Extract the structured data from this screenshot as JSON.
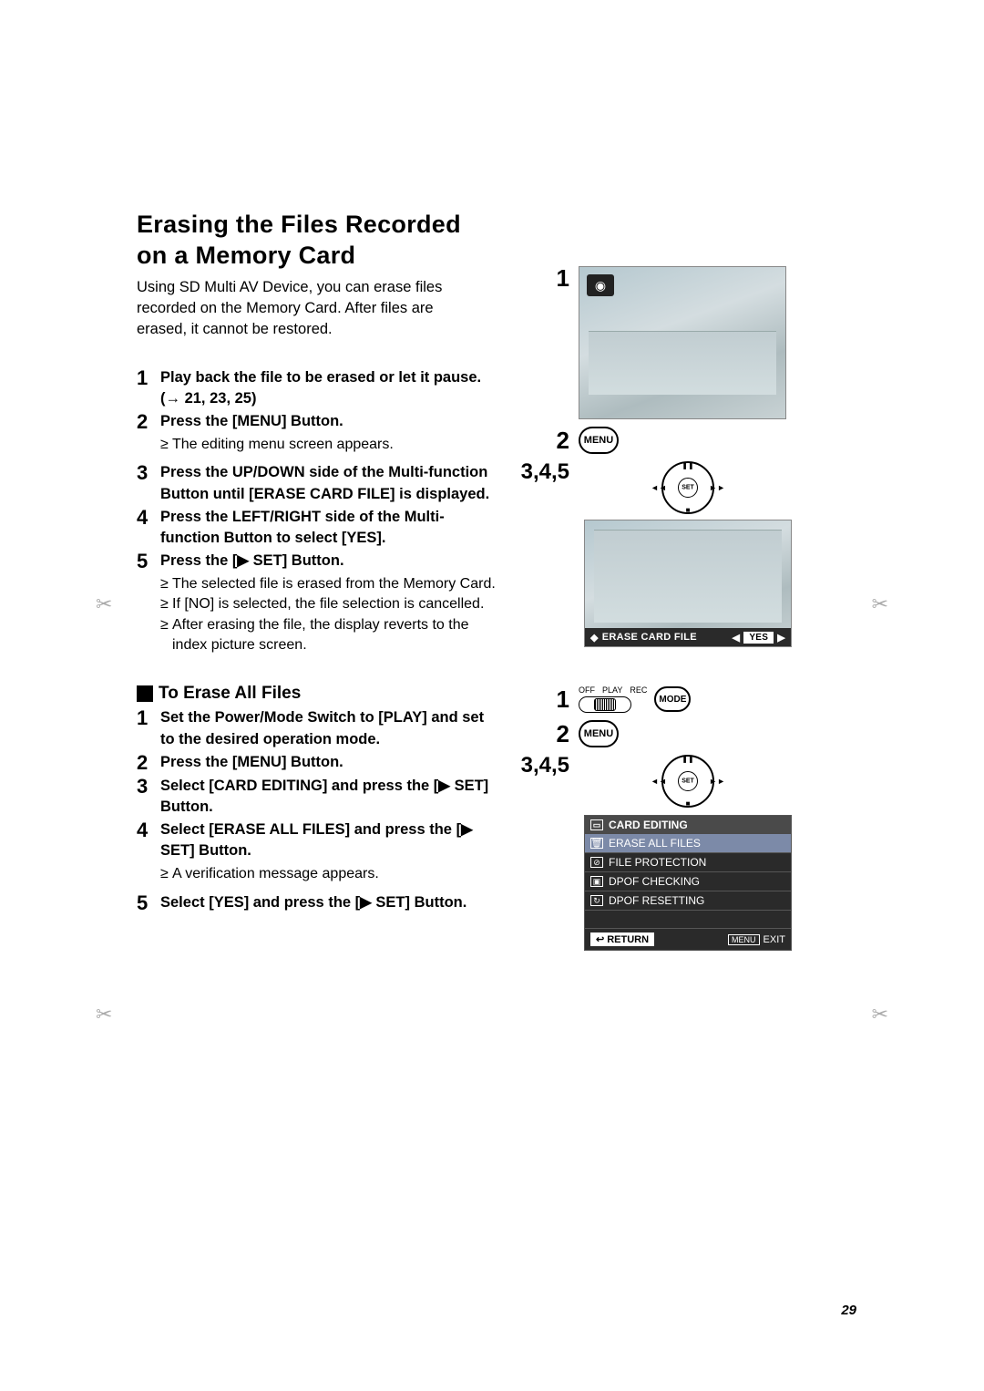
{
  "page": {
    "title": "Erasing the Files Recorded on a Memory Card",
    "intro": "Using SD Multi AV Device, you can erase files recorded on the Memory Card. After files are erased, it cannot be restored.",
    "page_number": "29"
  },
  "stepsA": [
    {
      "n": "1",
      "main": "Play back the file to be erased or let it pause. (→ 21, 23, 25)",
      "bullets": []
    },
    {
      "n": "2",
      "main": "Press the [MENU] Button.",
      "bullets": [
        "The editing menu screen appears."
      ]
    },
    {
      "n": "3",
      "main": "Press the UP/DOWN side of the Multi-function Button until [ERASE CARD FILE] is displayed.",
      "bullets": []
    },
    {
      "n": "4",
      "main": "Press the LEFT/RIGHT side of the Multi-function Button to select [YES].",
      "bullets": []
    },
    {
      "n": "5",
      "main": "Press the [▶ SET] Button.",
      "bullets": [
        "The selected file is erased from the Memory Card.",
        "If [NO] is selected, the file selection is cancelled.",
        "After erasing the file, the display reverts to the index picture screen."
      ]
    }
  ],
  "subheading": "To Erase All Files",
  "stepsB": [
    {
      "n": "1",
      "main": "Set the Power/Mode Switch to [PLAY] and set to the desired operation mode.",
      "bullets": []
    },
    {
      "n": "2",
      "main": "Press the [MENU] Button.",
      "bullets": []
    },
    {
      "n": "3",
      "main": "Select [CARD EDITING] and press the [▶ SET] Button.",
      "bullets": []
    },
    {
      "n": "4",
      "main": "Select [ERASE ALL FILES] and press the [▶ SET] Button.",
      "bullets": [
        "A verification message appears."
      ]
    },
    {
      "n": "5",
      "main": "Select [YES] and press the [▶ SET] Button.",
      "bullets": []
    }
  ],
  "figsA": {
    "step1": "1",
    "step2": "2",
    "step345": "3,4,5",
    "menu_label": "MENU",
    "barlabel": "ERASE CARD FILE",
    "yes": "YES",
    "joy_set": "SET"
  },
  "figsB": {
    "step1": "1",
    "step2": "2",
    "step345": "3,4,5",
    "mode_off": "OFF",
    "mode_play": "PLAY",
    "mode_rec": "REC",
    "mode_btn": "MODE",
    "menu_label": "MENU"
  },
  "menu_panel": {
    "title": "CARD EDITING",
    "rows": [
      "ERASE ALL FILES",
      "FILE PROTECTION",
      "DPOF CHECKING",
      "DPOF RESETTING"
    ],
    "return": "RETURN",
    "footer_menu": "MENU",
    "footer_exit": "EXIT"
  }
}
